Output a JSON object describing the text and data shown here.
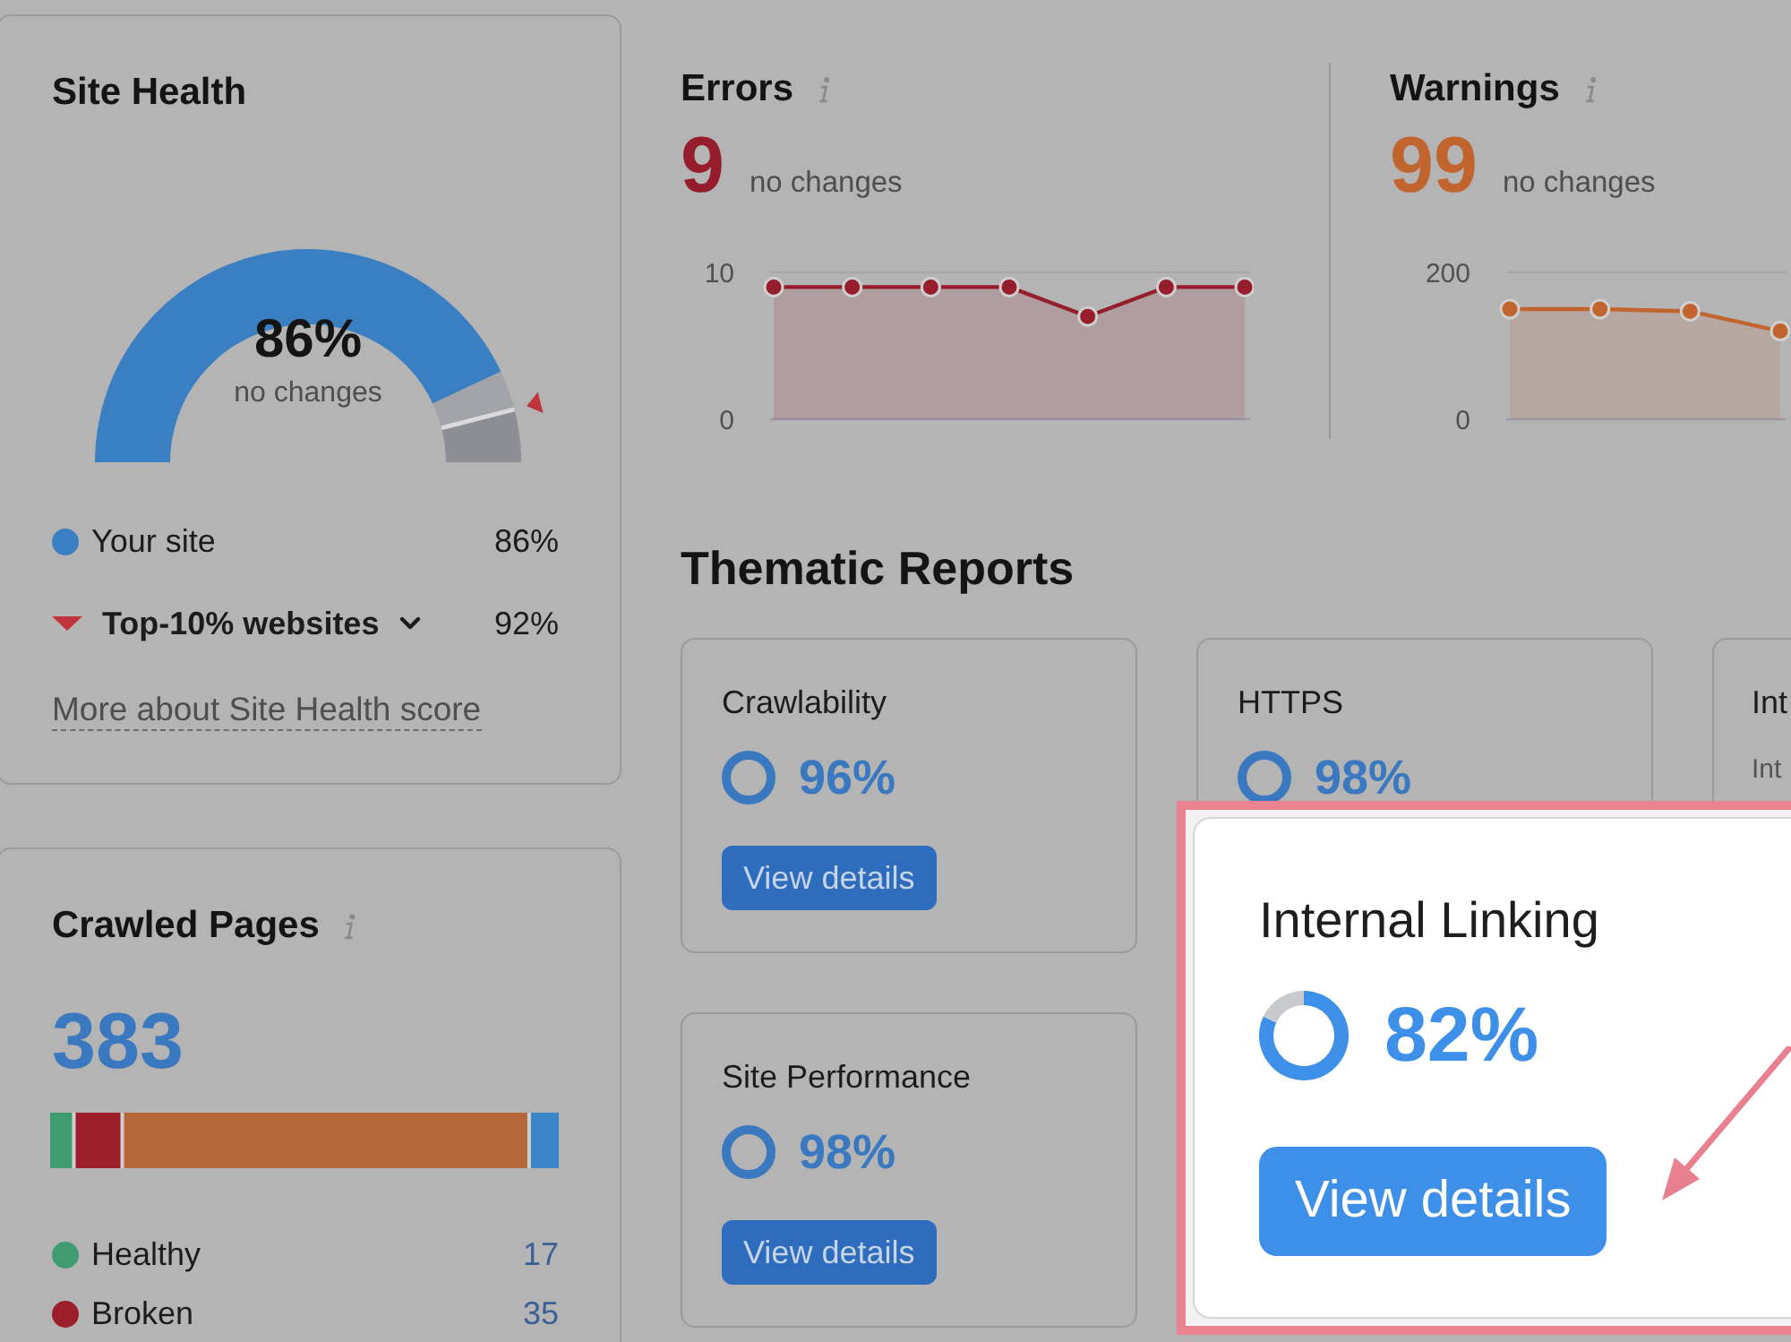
{
  "site_health": {
    "title": "Site Health",
    "gauge": {
      "value": "86%",
      "caption": "no changes",
      "chart_data": {
        "type": "donut",
        "values": [
          86,
          6,
          8
        ],
        "colors": [
          "#3b7fc3",
          "#a3a4a9",
          "#8d8e94"
        ]
      }
    },
    "legend": [
      {
        "kind": "site",
        "label": "Your site",
        "value": "86%",
        "color": "#3b7fc3"
      },
      {
        "kind": "benchmark",
        "label": "Top-10% websites",
        "value": "92%",
        "color": "#c0343e"
      }
    ],
    "link": "More about Site Health score"
  },
  "crawled_pages": {
    "title": "Crawled Pages",
    "total": "383",
    "legend": [
      {
        "label": "Healthy",
        "count": "17",
        "color": "#3f9b70"
      },
      {
        "label": "Broken",
        "count": "35",
        "color": "#9c1e2b"
      }
    ]
  },
  "errors": {
    "title": "Errors",
    "count": "9",
    "caption": "no changes",
    "chart_data": {
      "type": "area",
      "categories": [
        null,
        null,
        null,
        null,
        null,
        null,
        null
      ],
      "values": [
        9,
        9,
        9,
        9,
        7,
        9,
        9
      ],
      "color": "#951d2c",
      "ylim": [
        0,
        10
      ],
      "yticks": [
        0,
        10
      ],
      "marker": "circle"
    }
  },
  "warnings": {
    "title": "Warnings",
    "count": "99",
    "caption": "no changes",
    "chart_data": {
      "type": "area",
      "categories": [
        null,
        null,
        null,
        null
      ],
      "values": [
        150,
        150,
        147,
        120
      ],
      "color": "#c2642e",
      "ylim": [
        0,
        200
      ],
      "yticks": [
        0,
        200
      ],
      "marker": "circle"
    }
  },
  "thematic_reports": {
    "title": "Thematic Reports",
    "cards": [
      {
        "title": "Crawlability",
        "score": "96%",
        "button": "View details"
      },
      {
        "title": "HTTPS",
        "score": "98%"
      },
      {
        "title": "Int",
        "subtitle": "Int"
      },
      {
        "title": "Site Performance",
        "score": "98%",
        "button": "View details"
      }
    ]
  },
  "callout": {
    "title": "Internal Linking",
    "score": "82%",
    "chart_data": {
      "type": "donut",
      "values": [
        82,
        18
      ],
      "colors": [
        "#3d8fe8",
        "#c9cace"
      ]
    },
    "button": "View details"
  }
}
